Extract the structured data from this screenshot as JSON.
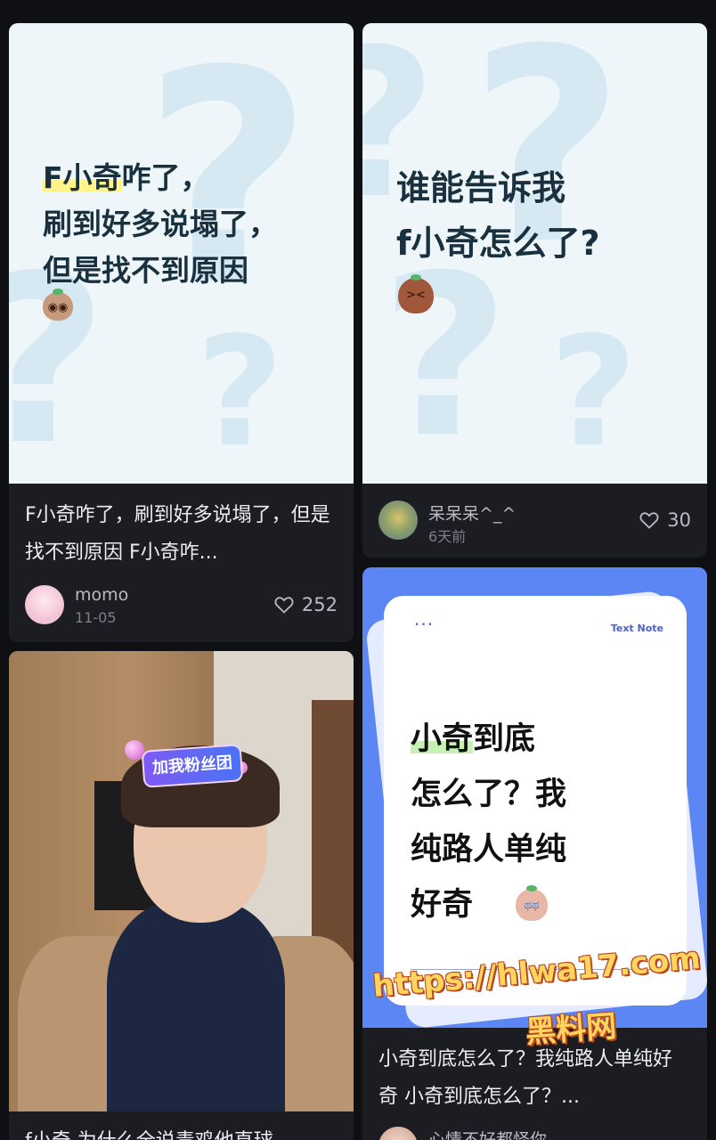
{
  "cards": [
    {
      "cover_line1": "F小奇",
      "cover_line1_rest": "咋了，",
      "cover_line2": "刷到好多说塌了，",
      "cover_line3": "但是找不到原因",
      "caption": "F小奇咋了，刷到好多说塌了，但是找不到原因 F小奇咋...",
      "author": "momo",
      "date": "11-05",
      "likes": "252"
    },
    {
      "cover_text": "谁能告诉我\nf小奇怎么了?",
      "author": "呆呆呆^_^",
      "date": "6天前",
      "likes": "30"
    },
    {
      "fan_badge": "加我粉丝团",
      "caption": "f小奇 为什么全说毒鸡他直球"
    },
    {
      "note_tag": "Text Note",
      "note_dots": "···",
      "note_line1_hl": "小奇",
      "note_line1_rest": "到底",
      "note_rest": "怎么了？我\n纯路人单纯\n好奇",
      "caption": "小奇到底怎么了？我纯路人单纯好奇 小奇到底怎么了？...",
      "author": "心情不好都怪你"
    }
  ],
  "watermark": {
    "url": "https://hlwa17.com",
    "name": "黑料网"
  },
  "colors": {
    "background": "#0f1014",
    "card": "#1c1d23",
    "cover_light": "#eef6fa",
    "note_blue": "#5d86f5",
    "watermark_gold": "#ffd560"
  }
}
